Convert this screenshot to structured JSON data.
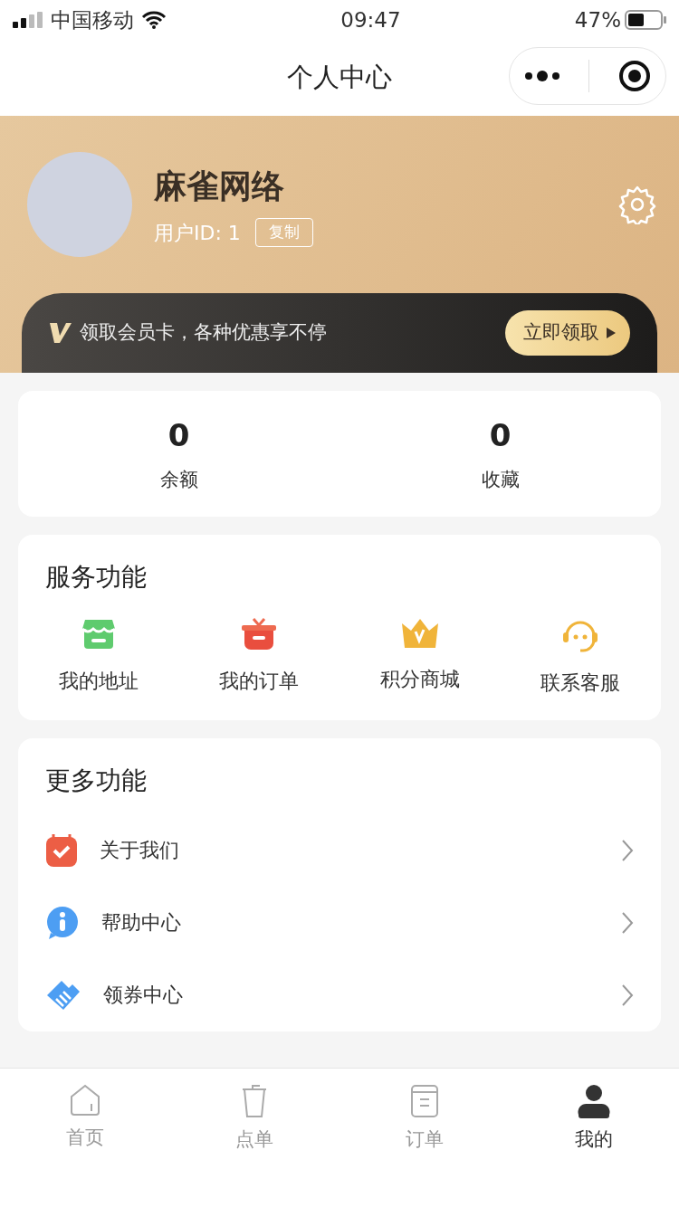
{
  "status_bar": {
    "carrier": "中国移动",
    "time": "09:47",
    "battery": "47%"
  },
  "nav": {
    "title": "个人中心"
  },
  "profile": {
    "name": "麻雀网络",
    "user_id": "用户ID: 1",
    "copy_button": "复制"
  },
  "member_banner": {
    "text": "领取会员卡，各种优惠享不停",
    "button": "立即领取"
  },
  "stats": [
    {
      "value": "0",
      "label": "余额"
    },
    {
      "value": "0",
      "label": "收藏"
    }
  ],
  "services": {
    "title": "服务功能",
    "items": [
      {
        "label": "我的地址",
        "kind": "address"
      },
      {
        "label": "我的订单",
        "kind": "order"
      },
      {
        "label": "积分商城",
        "kind": "mall"
      },
      {
        "label": "联系客服",
        "kind": "service"
      }
    ]
  },
  "more": {
    "title": "更多功能",
    "items": [
      {
        "label": "关于我们",
        "kind": "about"
      },
      {
        "label": "帮助中心",
        "kind": "help"
      },
      {
        "label": "领券中心",
        "kind": "coupon"
      }
    ]
  },
  "tabs": [
    {
      "label": "首页",
      "kind": "home",
      "selected": false
    },
    {
      "label": "点单",
      "kind": "cup",
      "selected": false
    },
    {
      "label": "订单",
      "kind": "list",
      "selected": false
    },
    {
      "label": "我的",
      "kind": "user",
      "selected": true
    }
  ]
}
